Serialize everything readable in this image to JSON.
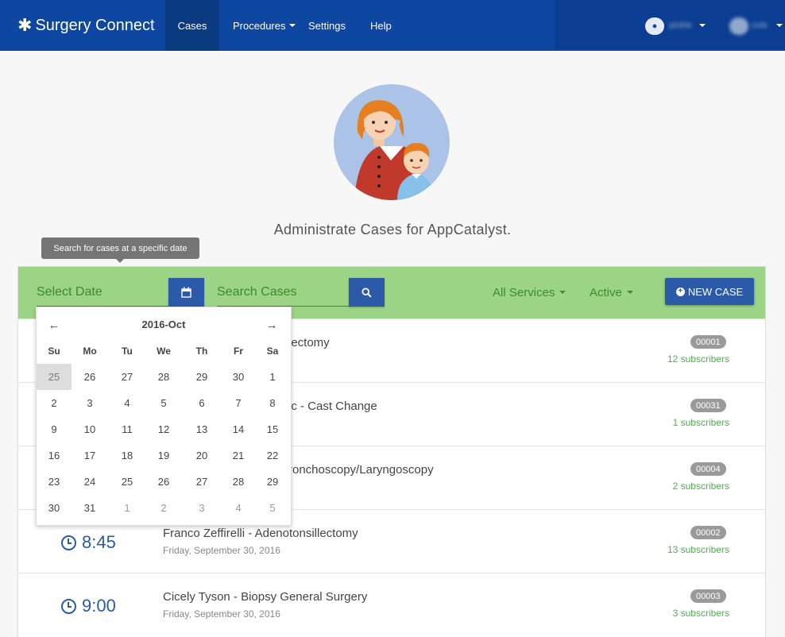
{
  "navbar": {
    "brand": "Surgery Connect",
    "brand_icon": "asterisk-icon",
    "items": [
      {
        "label": "Cases",
        "active": true
      },
      {
        "label": "Procedures"
      },
      {
        "label": "Settings"
      },
      {
        "label": "Help"
      }
    ],
    "location_label": "pinkle",
    "user_label": "cole"
  },
  "hero": {
    "title": "Administrate Cases for AppCatalyst."
  },
  "tooltip": "Search for cases at a specific date",
  "toolbar": {
    "date_placeholder": "Select Date",
    "search_placeholder": "Search Cases",
    "services_filter": "All Services",
    "status_filter": "Active",
    "new_case_label": "NEW CASE"
  },
  "cases": [
    {
      "time": "",
      "title": "lectomy",
      "date": "",
      "id": "00001",
      "subscribers": "12 subscribers"
    },
    {
      "time": "",
      "title": "ic - Cast Change",
      "date": "",
      "id": "00031",
      "subscribers": "1 subscribers"
    },
    {
      "time": "",
      "title": "ronchoscopy/Laryngoscopy",
      "date": "",
      "id": "00004",
      "subscribers": "2 subscribers"
    },
    {
      "time": "8:45",
      "title": "Franco Zeffirelli - Adenotonsillectomy",
      "date": "Friday, September 30, 2016",
      "id": "00002",
      "subscribers": "13 subscribers"
    },
    {
      "time": "9:00",
      "title": "Cicely Tyson - Biopsy General Surgery",
      "date": "Friday, September 30, 2016",
      "id": "00003",
      "subscribers": "3 subscribers"
    }
  ],
  "datepicker": {
    "title": "2016-Oct",
    "weekdays": [
      "Su",
      "Mo",
      "Tu",
      "We",
      "Th",
      "Fr",
      "Sa"
    ],
    "weeks": [
      [
        "25",
        "26",
        "27",
        "28",
        "29",
        "30",
        "1"
      ],
      [
        "2",
        "3",
        "4",
        "5",
        "6",
        "7",
        "8"
      ],
      [
        "9",
        "10",
        "11",
        "12",
        "13",
        "14",
        "15"
      ],
      [
        "16",
        "17",
        "18",
        "19",
        "20",
        "21",
        "22"
      ],
      [
        "23",
        "24",
        "25",
        "26",
        "27",
        "28",
        "29"
      ],
      [
        "30",
        "31",
        "1",
        "2",
        "3",
        "4",
        "5"
      ]
    ],
    "selected": "25"
  },
  "colors": {
    "navbar": "#0d47a1",
    "toolbar": "#9cd486",
    "primary_button": "#2a5aa8",
    "subscribers": "#4caf50"
  }
}
